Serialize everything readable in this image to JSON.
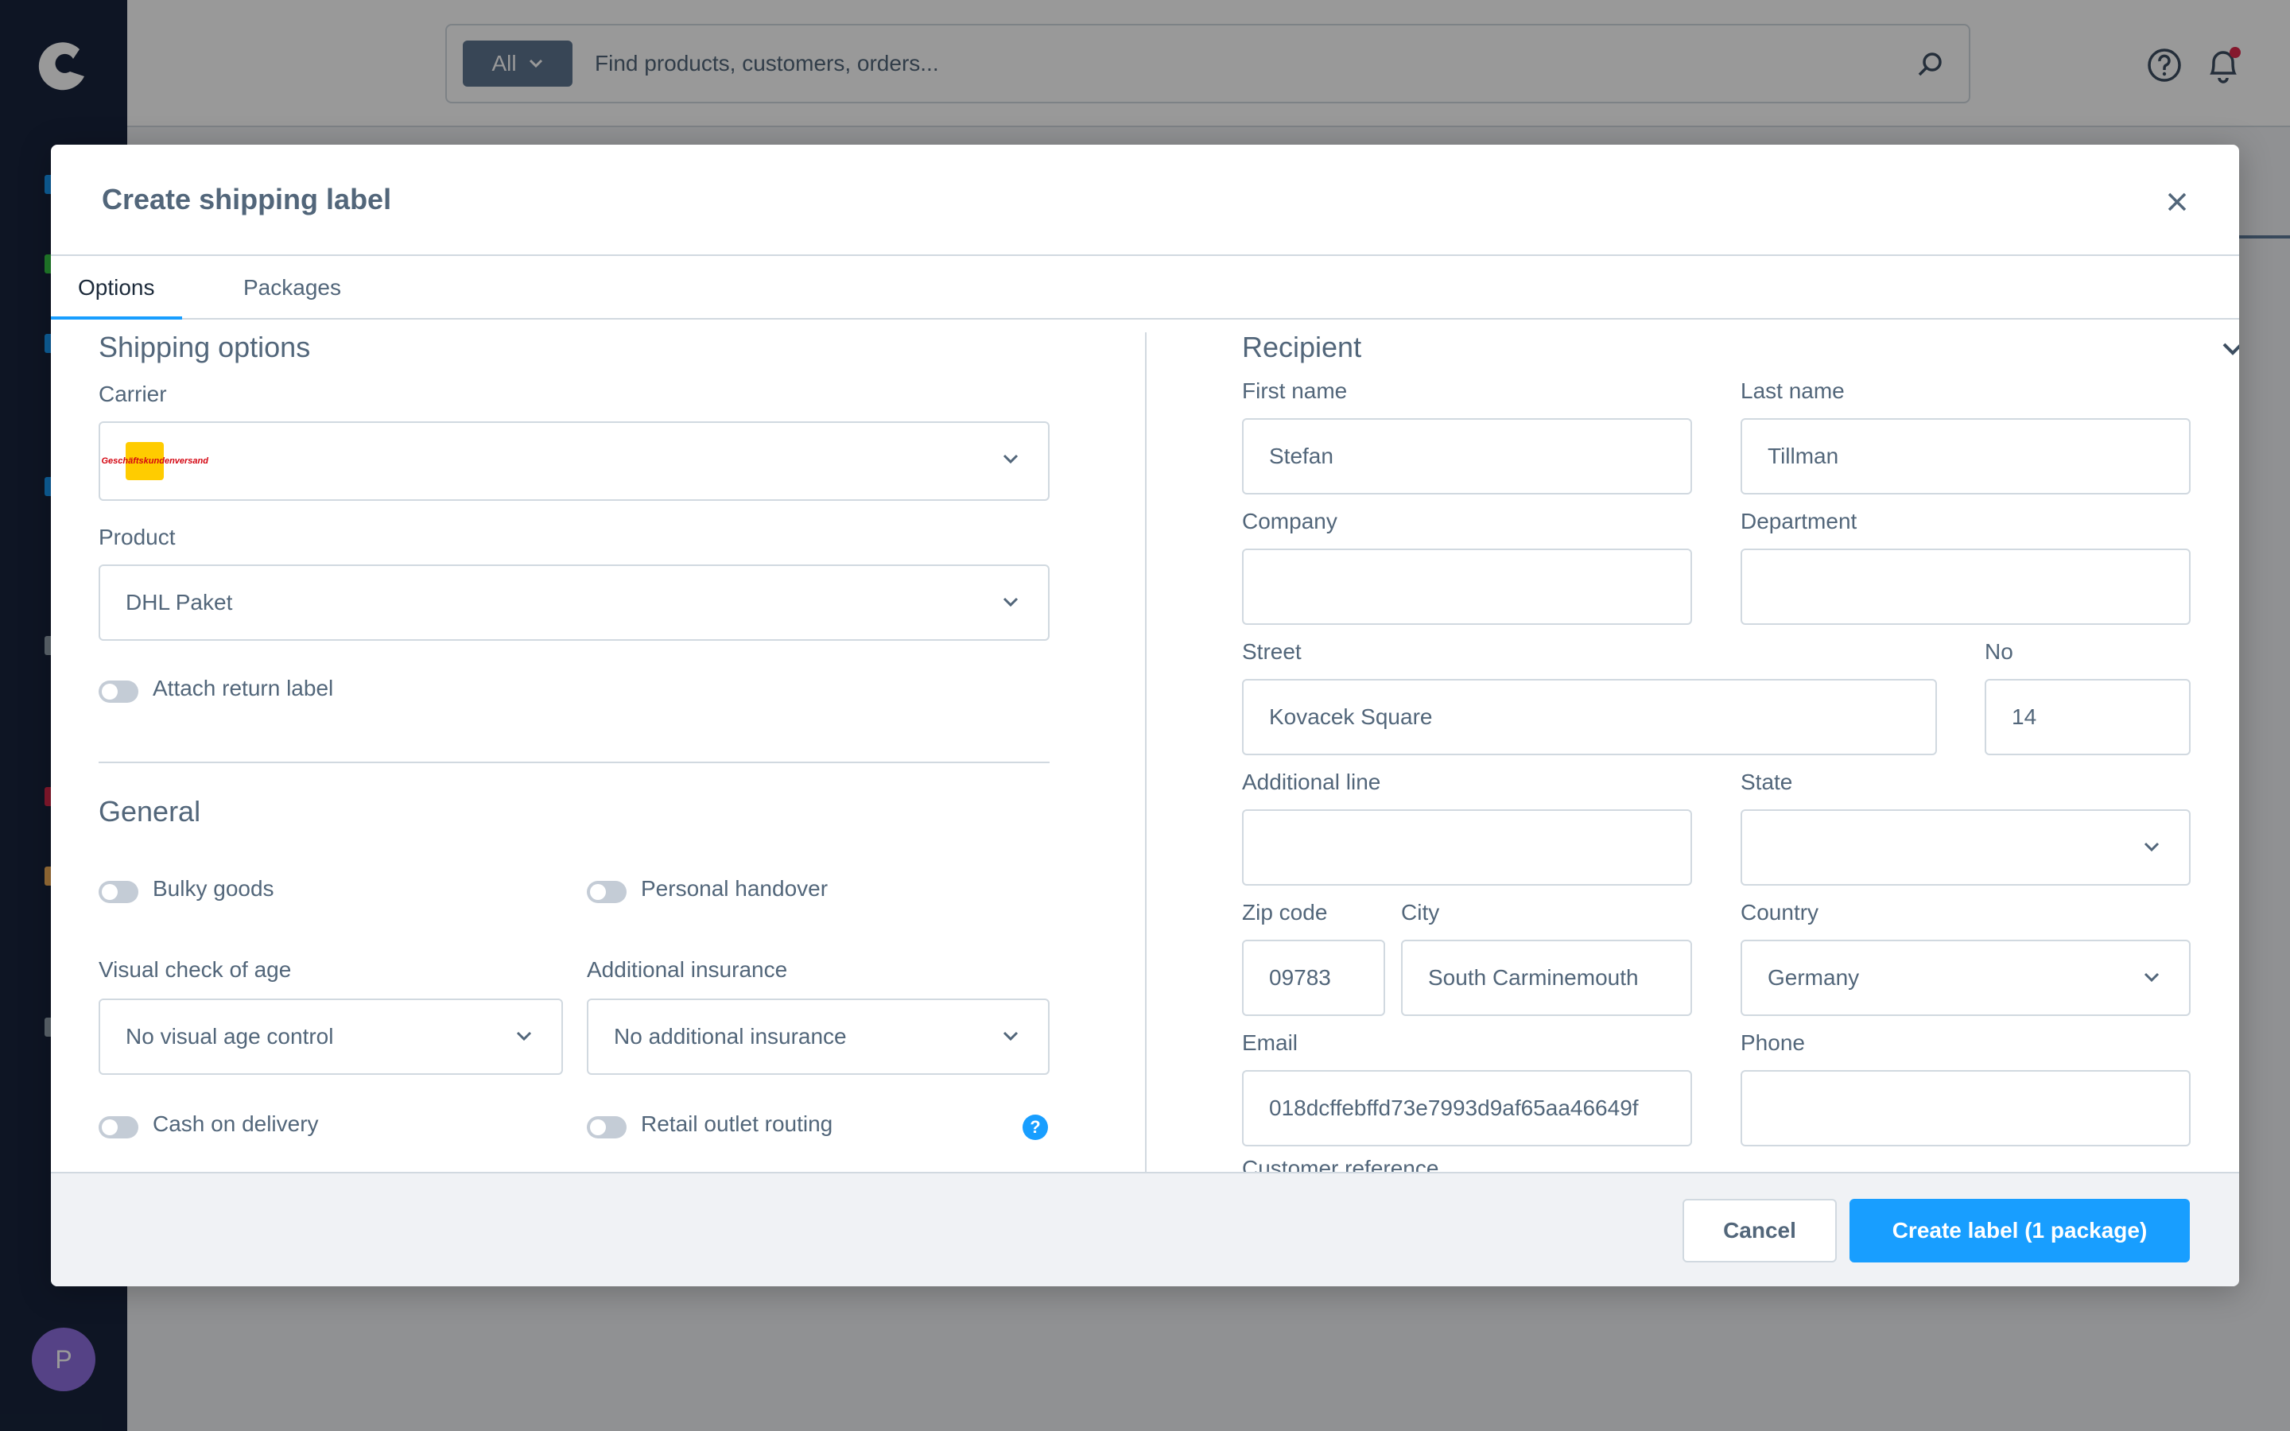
{
  "topbar": {
    "search_type": "All",
    "search_placeholder": "Find products, customers, orders..."
  },
  "user": {
    "avatar_initial": "P"
  },
  "modal": {
    "title": "Create shipping label",
    "tabs": [
      {
        "label": "Options"
      },
      {
        "label": "Packages"
      }
    ]
  },
  "shipping_options": {
    "title": "Shipping options",
    "carrier_label": "Carrier",
    "carrier_value": "DHL Geschäftskundenversand",
    "carrier_logo_text": "DHL",
    "product_label": "Product",
    "product_value": "DHL Paket",
    "attach_return_label": "Attach return label"
  },
  "general": {
    "title": "General",
    "bulky_goods": "Bulky goods",
    "personal_handover": "Personal handover",
    "visual_check_label": "Visual check of age",
    "visual_check_value": "No visual age control",
    "insurance_label": "Additional insurance",
    "insurance_value": "No additional insurance",
    "cash_on_delivery": "Cash on delivery",
    "retail_outlet_routing": "Retail outlet routing",
    "help_glyph": "?"
  },
  "recipient": {
    "title": "Recipient",
    "first_name_label": "First name",
    "first_name": "Stefan",
    "last_name_label": "Last name",
    "last_name": "Tillman",
    "company_label": "Company",
    "company": "",
    "department_label": "Department",
    "department": "",
    "street_label": "Street",
    "street": "Kovacek Square",
    "no_label": "No",
    "no": "14",
    "additional_line_label": "Additional line",
    "additional_line": "",
    "state_label": "State",
    "state": "",
    "zip_label": "Zip code",
    "zip": "09783",
    "city_label": "City",
    "city": "South Carminemouth",
    "country_label": "Country",
    "country": "Germany",
    "email_label": "Email",
    "email": "018dcffebffd73e7993d9af65aa46649f",
    "phone_label": "Phone",
    "phone": "",
    "customer_reference_label": "Customer reference"
  },
  "footer": {
    "cancel": "Cancel",
    "create": "Create label (1 package)"
  },
  "colors": {
    "primary": "#189eff",
    "sidebar": "#18243c",
    "text": "#52667a",
    "border": "#d1d9e0",
    "dhl_yellow": "#ffcc00",
    "dhl_red": "#d40511",
    "notification_dot": "#de294c"
  }
}
